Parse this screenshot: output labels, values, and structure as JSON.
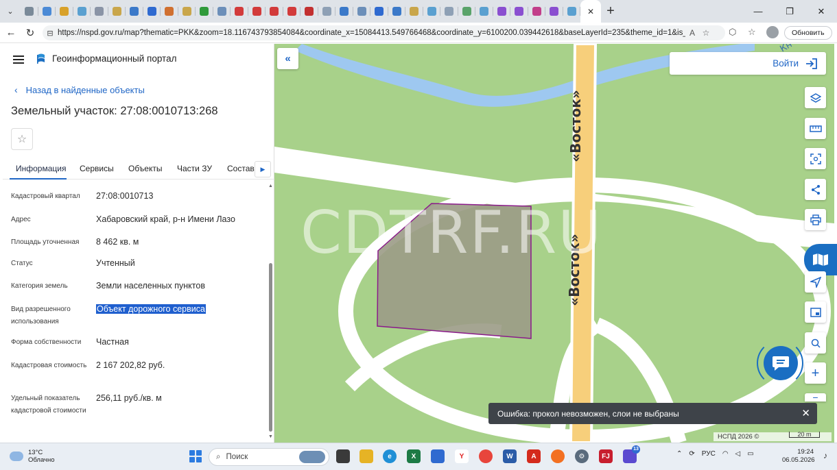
{
  "browser": {
    "url": "https://nspd.gov.ru/map?thematic=PKK&zoom=18.116743793854084&coordinate_x=15084413.549766468&coordinate_y=6100200.039442618&baseLayerId=235&theme_id=1&is_cop...",
    "update_label": "Обновить",
    "tab_colors": [
      "#7a8a99",
      "#4b8ad6",
      "#d8a12a",
      "#5aa0d0",
      "#8a94a6",
      "#c9a64b",
      "#3b79c9",
      "#2f6ad0",
      "#d07030",
      "#c9a64b",
      "#2f9a3b",
      "#6c8fb9",
      "#d23b3b",
      "#d23b3b",
      "#d23b3b",
      "#d23b3b",
      "#c23030",
      "#8ea0b5",
      "#3b79c9",
      "#6c8fb9",
      "#2f6ad0",
      "#3b79c9",
      "#c9a64b",
      "#5aa0d0",
      "#8ea0b5",
      "#5aa36a",
      "#5aa0d0",
      "#8a4fd0",
      "#8a4fd0",
      "#c23e8a",
      "#8a4fd0",
      "#5aa0d0",
      "#5aa0d0"
    ]
  },
  "panel": {
    "portal_title": "Геоинформационный портал",
    "back_label": "Назад в найденные объекты",
    "parcel_title": "Земельный участок: 27:08:0010713:268",
    "tabs": [
      "Информация",
      "Сервисы",
      "Объекты",
      "Части ЗУ",
      "Состав"
    ],
    "fields": [
      {
        "label": "Кадастровый квартал",
        "value": "27:08:0010713"
      },
      {
        "label": "Адрес",
        "value": "Хабаровский край, р-н Имени Лазо"
      },
      {
        "label": "Площадь уточненная",
        "value": "8 462 кв. м"
      },
      {
        "label": "Статус",
        "value": "Учтенный"
      },
      {
        "label": "Категория земель",
        "value": "Земли населенных пунктов"
      },
      {
        "label": "Вид разрешенного использования",
        "value": "Объект дорожного сервиса"
      },
      {
        "label": "Форма собственности",
        "value": "Частная"
      },
      {
        "label": "Кадастровая стоимость",
        "value": "2 167 202,82 руб."
      },
      {
        "label": "Удельный показатель кадастровой стоимости",
        "value": "256,11 руб./кв. м"
      }
    ]
  },
  "map": {
    "road_label": "«Восток»",
    "road_label_2": "«Восток»",
    "corner_label": "Кн",
    "watermark": "CDTRF.RU",
    "login_label": "Войти",
    "toast": "Ошибка: прокол невозможен, слои не выбраны",
    "attribution": "НСПД 2026 ©",
    "scale": "20 m",
    "colors": {
      "grass": "#a8d18a",
      "road": "#ffffff",
      "highway": "#f7cf7b",
      "water": "#9ec8f0",
      "parcel_stroke": "#8a1a8a",
      "accent": "#1a6ec2"
    }
  },
  "taskbar": {
    "temperature": "13°C",
    "weather": "Облачно",
    "search_placeholder": "Поиск",
    "lang": "РУС",
    "time": "19:24",
    "date": "06.05.2026",
    "badge": "13"
  }
}
